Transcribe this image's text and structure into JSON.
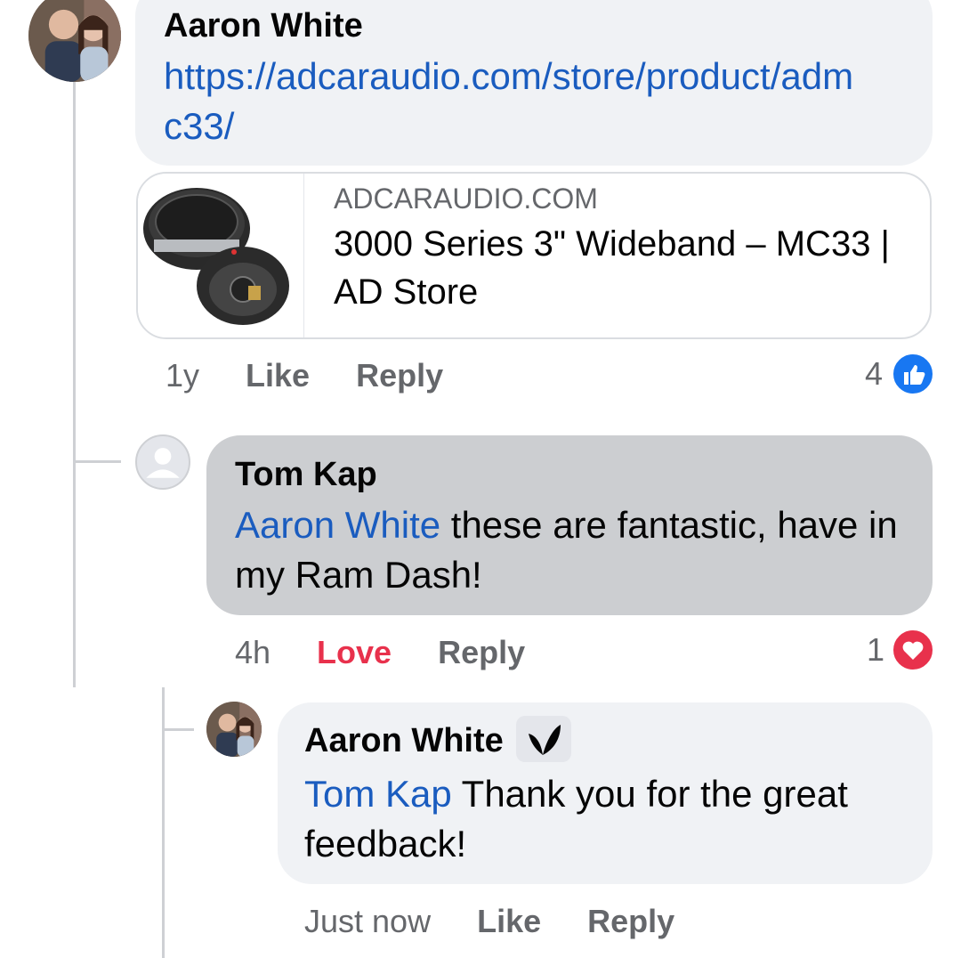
{
  "comments": [
    {
      "author": "Aaron White",
      "link_text": "https://adcaraudio.com/store/product/admc33/",
      "preview": {
        "domain": "ADCARAUDIO.COM",
        "title": "3000 Series 3\" Wideband – MC33 | AD Store"
      },
      "time": "1y",
      "like_label": "Like",
      "reply_label": "Reply",
      "reaction_count": "4",
      "reaction_icon": "like-icon"
    },
    {
      "author": "Tom Kap",
      "mention": "Aaron White",
      "text": " these are fantastic, have in my Ram Dash!",
      "time": "4h",
      "like_label": "Love",
      "reply_label": "Reply",
      "reaction_count": "1",
      "reaction_icon": "heart-icon"
    },
    {
      "author": "Aaron White",
      "badge_icon": "leaf-icon",
      "mention": "Tom Kap",
      "text": " Thank you for the great feedback!",
      "time": "Just now",
      "like_label": "Like",
      "reply_label": "Reply"
    }
  ],
  "colors": {
    "mention": "#1a5cbf",
    "love": "#e8314c",
    "like_blue": "#1877f2",
    "bubble_light": "#f0f2f5",
    "bubble_dark": "#ccced1"
  }
}
